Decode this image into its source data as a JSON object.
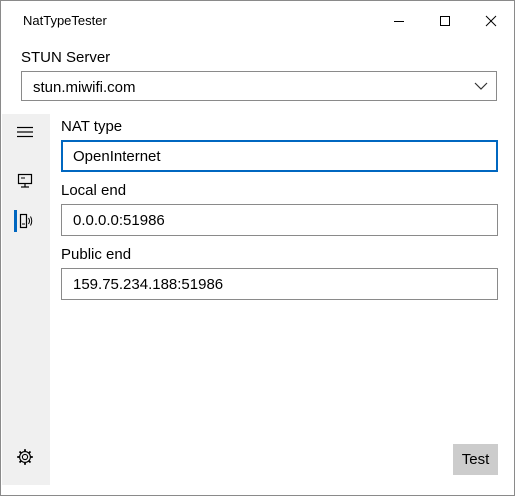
{
  "window": {
    "title": "NatTypeTester",
    "minimize_icon": "minimize-icon",
    "maximize_icon": "maximize-icon",
    "close_icon": "close-icon"
  },
  "stun": {
    "label": "STUN Server",
    "value": "stun.miwifi.com",
    "dropdown_icon": "chevron-down-icon"
  },
  "sidebar": {
    "items": [
      {
        "icon": "hamburger-menu-icon"
      },
      {
        "icon": "monitor-icon"
      },
      {
        "icon": "network-icon",
        "selected": true
      },
      {
        "icon": "gear-icon"
      }
    ],
    "accent": "#0067c0"
  },
  "main": {
    "nat_type": {
      "label": "NAT type",
      "value": "OpenInternet"
    },
    "local_end": {
      "label": "Local end",
      "value": "0.0.0.0:51986"
    },
    "public_end": {
      "label": "Public end",
      "value": "159.75.234.188:51986"
    },
    "test_label": "Test"
  }
}
